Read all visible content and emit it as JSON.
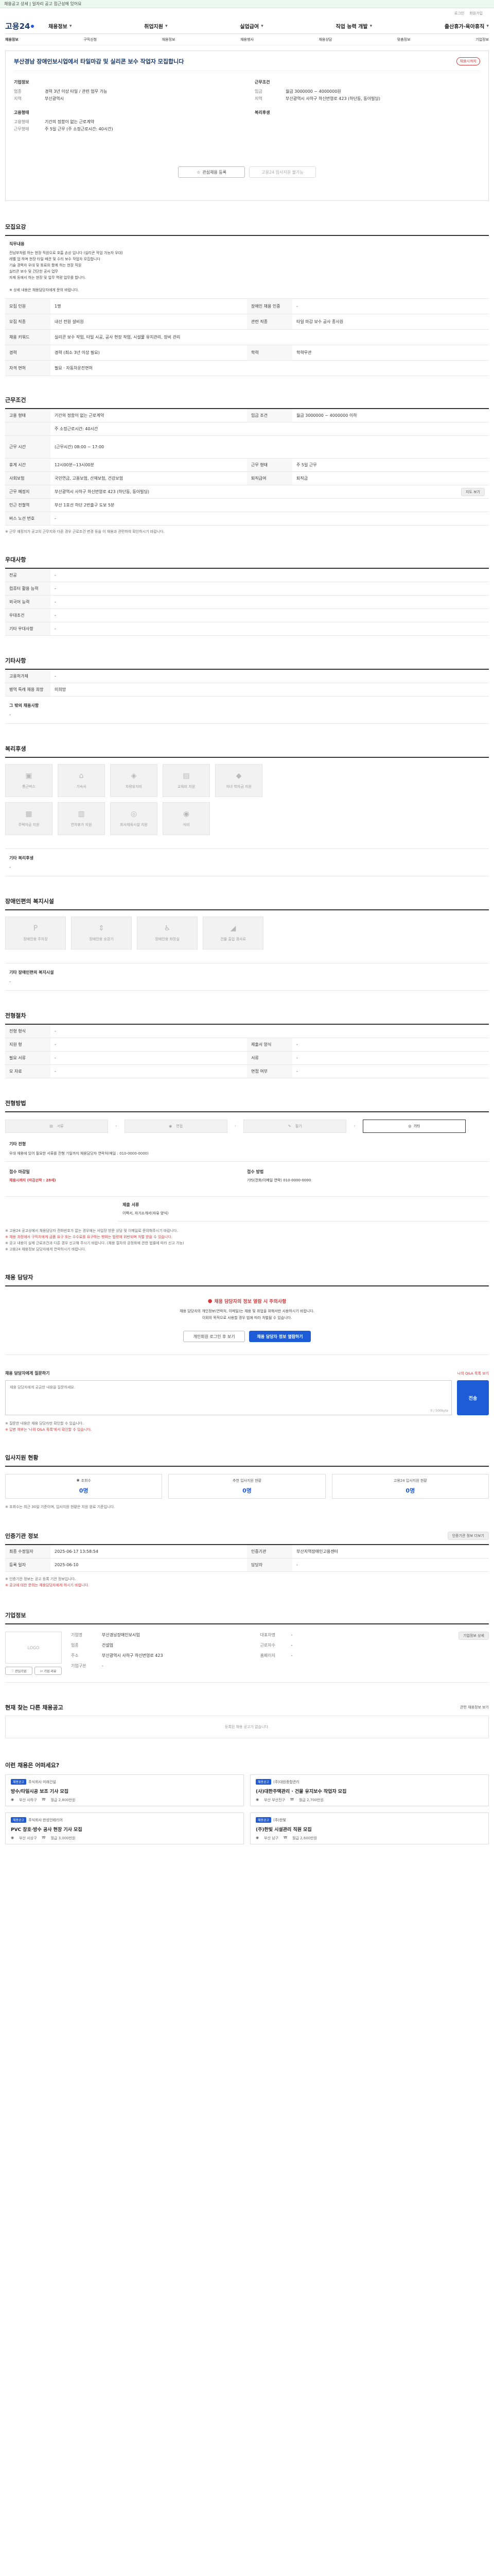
{
  "topbar": {
    "notice": "채용공고 상세 | 일자리 공고 접근성에 있어요"
  },
  "util": {
    "links": [
      "로그인",
      "회원가입"
    ]
  },
  "logo": {
    "text": "고용24"
  },
  "gnb": {
    "items": [
      "채용정보",
      "취업지원",
      "실업급여",
      "직업 능력 개발",
      "출산휴가·육아휴직"
    ]
  },
  "subnav": {
    "items": [
      "채용정보",
      "구직신청",
      "채용정보",
      "채용행사",
      "채용상담",
      "맞춤정보",
      "기업정보"
    ]
  },
  "header": {
    "title": "부산경남 장애인보시업에서 타일마감 및 실리콘 보수 작업자 모집합니다",
    "status_badge": "채용시까지",
    "company_heading": "기업정보",
    "company": [
      {
        "k": "업종",
        "v": "경력 3년 이상 타일 / 관련 업무 가능"
      },
      {
        "k": "지역",
        "v": "부산광역시"
      }
    ],
    "conditions_heading": "근무조건",
    "conditions": [
      {
        "k": "임금",
        "v": "월급 3000000 ~ 4000000원"
      },
      {
        "k": "지역",
        "v": "부산광역시 사하구 하신번영로 423 (하단동, 동아빌딩)"
      }
    ],
    "employ_heading": "고용형태",
    "employ": [
      {
        "k": "고용형태",
        "v": "기간의 정함이 없는 근로계약"
      },
      {
        "k": "근무형태",
        "v": "주 5일 근무 (주 소정근로시간: 40시간)"
      }
    ],
    "welfare_heading": "복리후생",
    "btn_apply": "관심채용 등록",
    "btn_apply2": "고용24 입사지원 불가능"
  },
  "recruit": {
    "title": "모집요강",
    "job_heading": "직무내용",
    "job_lines": [
      "전남부처럼 하는 현장 직원으로 호흡 손상 입니다 (실리콘 작업 가능자 우대)",
      "레벨 업 하며 현장 타일 배관 및 수리 보수 작업자 모집합니다",
      "기술 경력자 우대 및 동료와 함께 하는 현장 직원",
      "실리콘 보수 및 간단한 공사 업무",
      "자재 등에서 하는 현장 및 업무 역량 업무를 합니다.",
      "",
      "※ 상세 내용은 채용담당자에게 문의 바랍니다."
    ],
    "rows": [
      [
        {
          "k": "모집 인원",
          "v": "1명"
        },
        {
          "k": "장애인 채용 인증",
          "v": "-"
        }
      ],
      [
        {
          "k": "모집 직종",
          "v": "내선 전원 설비원"
        },
        {
          "k": "관련 직종",
          "v": "타일 마감 보수 공사 종사원"
        }
      ],
      [
        {
          "k": "채용 키워드",
          "v": "실리콘 보수 작업, 타일 시공, 공사 현장 작업, 시설물 유지관리, 장비 관리"
        },
        {
          "k": "",
          "v": ""
        }
      ],
      [
        {
          "k": "경력",
          "v": "경력 (최소 3년 이상 필요)"
        },
        {
          "k": "학력",
          "v": "학력무관"
        }
      ],
      [
        {
          "k": "자격 면허",
          "v": "필요 · 자동차운전면허"
        },
        {
          "k": "",
          "v": ""
        }
      ]
    ]
  },
  "work": {
    "title": "근무조건",
    "rows": [
      [
        {
          "k": "고용 형태",
          "v": "기간의 정함이 없는 근로계약"
        },
        {
          "k": "임금 조건",
          "v": "월급 3000000 ~ 4000000 이하"
        }
      ],
      [
        {
          "k": "",
          "v": "주 소정근로시간: 40시간"
        },
        {
          "k": "",
          "v": ""
        }
      ],
      [
        {
          "k": "근무 시간",
          "v": "(근무시간) 08:00 ~ 17:00"
        },
        {
          "k": "",
          "v": ""
        }
      ],
      [
        {
          "k": "휴게 시간",
          "v": "12시00분~13시00분"
        },
        {
          "k": "근무 형태",
          "v": "주 5일 근무"
        }
      ],
      [
        {
          "k": "사회보험",
          "v": "국민연금, 고용보험, 산재보험, 건강보험"
        },
        {
          "k": "퇴직급여",
          "v": "퇴직금"
        }
      ],
      [
        {
          "k": "근무 예정지",
          "v": "부산광역시 사하구 하신번영로 423 (하단동, 동아빌딩)"
        },
        {
          "k": "",
          "v": ""
        }
      ],
      [
        {
          "k": "인근 전철역",
          "v": "부산 1호선 하단 2번출구 도보 5분"
        },
        {
          "k": "",
          "v": ""
        }
      ],
      [
        {
          "k": "버스 노선 번호",
          "v": "-"
        },
        {
          "k": "",
          "v": ""
        }
      ]
    ],
    "map_btn": "지도 보기",
    "note": "※ 근무 예정지가 공고의 근무지와 다른 경우 근로조건 변경 등을 이 채용과 관련하여 확인하시기 바랍니다."
  },
  "prefer": {
    "title": "우대사항",
    "rows": [
      {
        "k": "전공",
        "v": "-"
      },
      {
        "k": "컴퓨터 활용 능력",
        "v": "-"
      },
      {
        "k": "외국어 능력",
        "v": "-"
      },
      {
        "k": "우대조건",
        "v": "-"
      },
      {
        "k": "기타 우대사항",
        "v": "-"
      }
    ]
  },
  "etc": {
    "title": "기타사항",
    "rows": [
      {
        "k": "고용허가제",
        "v": "-"
      },
      {
        "k": "병역 특례 채용 희망",
        "v": "미희망"
      }
    ],
    "other_heading": "그 밖의 채용사항",
    "other_value": "-"
  },
  "welfare": {
    "title": "복리후생",
    "tiles": [
      "통근버스",
      "기숙사",
      "차량유지비",
      "교육비 지원",
      "자녀 학자금 지원",
      "주택자금 지원",
      "연차휴가 지원",
      "회사체육시설 지원",
      "식비"
    ],
    "other_heading": "기타 복리후생",
    "other_value": "-"
  },
  "disability": {
    "title": "장애인편의 복지시설",
    "tiles": [
      "장애인용 주차장",
      "장애인용 승강기",
      "장애인용 화장실",
      "건물 출입 경사로"
    ],
    "other_heading": "기타 장애인편의 복지시설",
    "other_value": "-"
  },
  "process": {
    "title": "전형절차",
    "rows": [
      [
        {
          "k": "전형 형식",
          "v": "-"
        },
        {
          "k": "",
          "v": ""
        }
      ],
      [
        {
          "k": "지원 형",
          "v": "-"
        },
        {
          "k": "제출서 양식",
          "v": "-"
        }
      ],
      [
        {
          "k": "필요 서류",
          "v": "-"
        },
        {
          "k": "서류",
          "v": "-"
        }
      ],
      [
        {
          "k": "모 자료",
          "v": "-"
        },
        {
          "k": "면접 여부",
          "v": "-"
        }
      ]
    ]
  },
  "apply_method": {
    "title": "전형방법",
    "steps": [
      "서류",
      "면접",
      "필기",
      "기타"
    ],
    "other_heading": "기타 전형",
    "other_value": "우대 채용에 있어 필요한 서류를 전형 기일까지 채용담당자 연락처(매일 : 010-0000-0000)",
    "cols": [
      {
        "k": "접수 마감일",
        "v": "채용시까지 (마감선착 : 28세)",
        "v2": ""
      },
      {
        "k": "접수 방법",
        "v": "기타(전화/이메일 연락) 010-0000-0000",
        "v2": ""
      },
      {
        "k": "제출 서류",
        "v": "이력서, 자기소개서(자유 양식)",
        "v2": ""
      }
    ],
    "notes": [
      "※ 고용24 공고상에서 채용담당자 전화번호가 없는 경우에는 사업장 방문 상담 및 이메일로 문의해주시기 바랍니다.",
      "※ 채용 과정에서 구직자에게 금품 요구 또는 수수료를 요구하는 행위는 법령에 위반되며 처벌 받을 수 있습니다.",
      "※ 공고 내용이 실제 근로조건과 다른 경우 신고해 주시기 바랍니다. (채용 절차의 공정화에 관한 법률에 따라 신고 가능)",
      "※ 고용24 채용정보 담당자에게 연락하시기 바랍니다."
    ]
  },
  "contact": {
    "title": "채용 담당자",
    "warn_title": "채용 담당자의 정보 열람 시 주의사항",
    "warn_lines": [
      "채용 담당자의 개인정보(연락처, 이메일)는 채용 및 취업을 위해서만 사용하시기 바랍니다.",
      "이외의 목적으로 사용할 경우 법에 따라 처벌될 수 있습니다."
    ],
    "btn_login": "개인회원 로그인 후 보기",
    "btn_view": "채용 담당자 정보 열람하기"
  },
  "inquiry": {
    "title": "채용 담당자에게 질문하기",
    "link": "나의 Q&A 목록 보기",
    "placeholder": "채용 담당자에게 궁금한 내용을 질문하세요.",
    "count": "0 / 500byte",
    "submit": "전송",
    "notes": [
      "※ 질문한 내용은 채용 담당자만 확인할 수 있습니다.",
      "※ 답변 여부는 '나의 Q&A 목록'에서 확인할 수 있습니다."
    ]
  },
  "apply_status": {
    "title": "입사지원 현황",
    "items": [
      {
        "label": "조회수",
        "value": "0명"
      },
      {
        "label": "추천 입사지원 현황",
        "value": "0명"
      },
      {
        "label": "고용24 입사지원 현황",
        "value": "0명"
      }
    ],
    "note": "※ 조회수는 최근 30일 기준이며, 입사지원 현황은 지원 완료 기준입니다."
  },
  "certified": {
    "title": "인증기관 정보",
    "btn": "인증기관 정보 더보기",
    "rows": [
      [
        {
          "k": "최종 수정일자",
          "v": "2025-06-17 13:58:54"
        },
        {
          "k": "인증기관",
          "v": "부산지역장애인고용센터"
        }
      ],
      [
        {
          "k": "등록 일자",
          "v": "2025-06-10"
        },
        {
          "k": "담당자",
          "v": "-"
        }
      ]
    ],
    "notes": [
      "※ 인증기관 정보는 공고 등록 기관 정보입니다.",
      "※ 공고에 대한 문의는 채용담당자에게 하시기 바랍니다."
    ]
  },
  "company": {
    "title": "기업정보",
    "logo": "LOGO",
    "rows": [
      [
        {
          "k": "기업명",
          "v": "부산경남장애인보시업"
        },
        {
          "k": "대표자명",
          "v": "-"
        }
      ],
      [
        {
          "k": "업종",
          "v": "건설업"
        },
        {
          "k": "근로자수",
          "v": "-"
        }
      ],
      [
        {
          "k": "주소",
          "v": "부산광역시 사하구 하신번영로 423"
        },
        {
          "k": "홈페이지",
          "v": "-"
        }
      ],
      [
        {
          "k": "기업구분",
          "v": "-"
        },
        {
          "k": "",
          "v": ""
        }
      ]
    ],
    "btn_detail": "기업정보 상세",
    "btn_follow1": "관심기업",
    "btn_follow2": "기업 리뷰"
  },
  "other_jobs": {
    "title": "현재 찾는 다른 채용공고",
    "empty": "등록된 채용 공고가 없습니다.",
    "link": "관련 채용정보 보기"
  },
  "recommend": {
    "title": "이런 채용은 어떠세요?",
    "cards": [
      {
        "badge": "채용공고",
        "company": "주식회사 미래건설",
        "title": "방수/타일시공 보조 기사 모집",
        "loc": "부산 사하구",
        "pay": "월급 2,800만원"
      },
      {
        "badge": "채용공고",
        "company": "(주)대원종합관리",
        "title": "(사)대한주택관리 · 건물 유지보수 작업자 모집",
        "loc": "부산 부산진구",
        "pay": "월급 2,700만원"
      },
      {
        "badge": "채용공고",
        "company": "주식회사 한성인테리어",
        "title": "PVC 창호·방수 공사 현장 기사 모집",
        "loc": "부산 사상구",
        "pay": "월급 3,000만원"
      },
      {
        "badge": "채용공고",
        "company": "(주)한빛",
        "title": "(주)한빛 시설관리 직원 모집",
        "loc": "부산 남구",
        "pay": "월급 2,600만원"
      }
    ]
  }
}
